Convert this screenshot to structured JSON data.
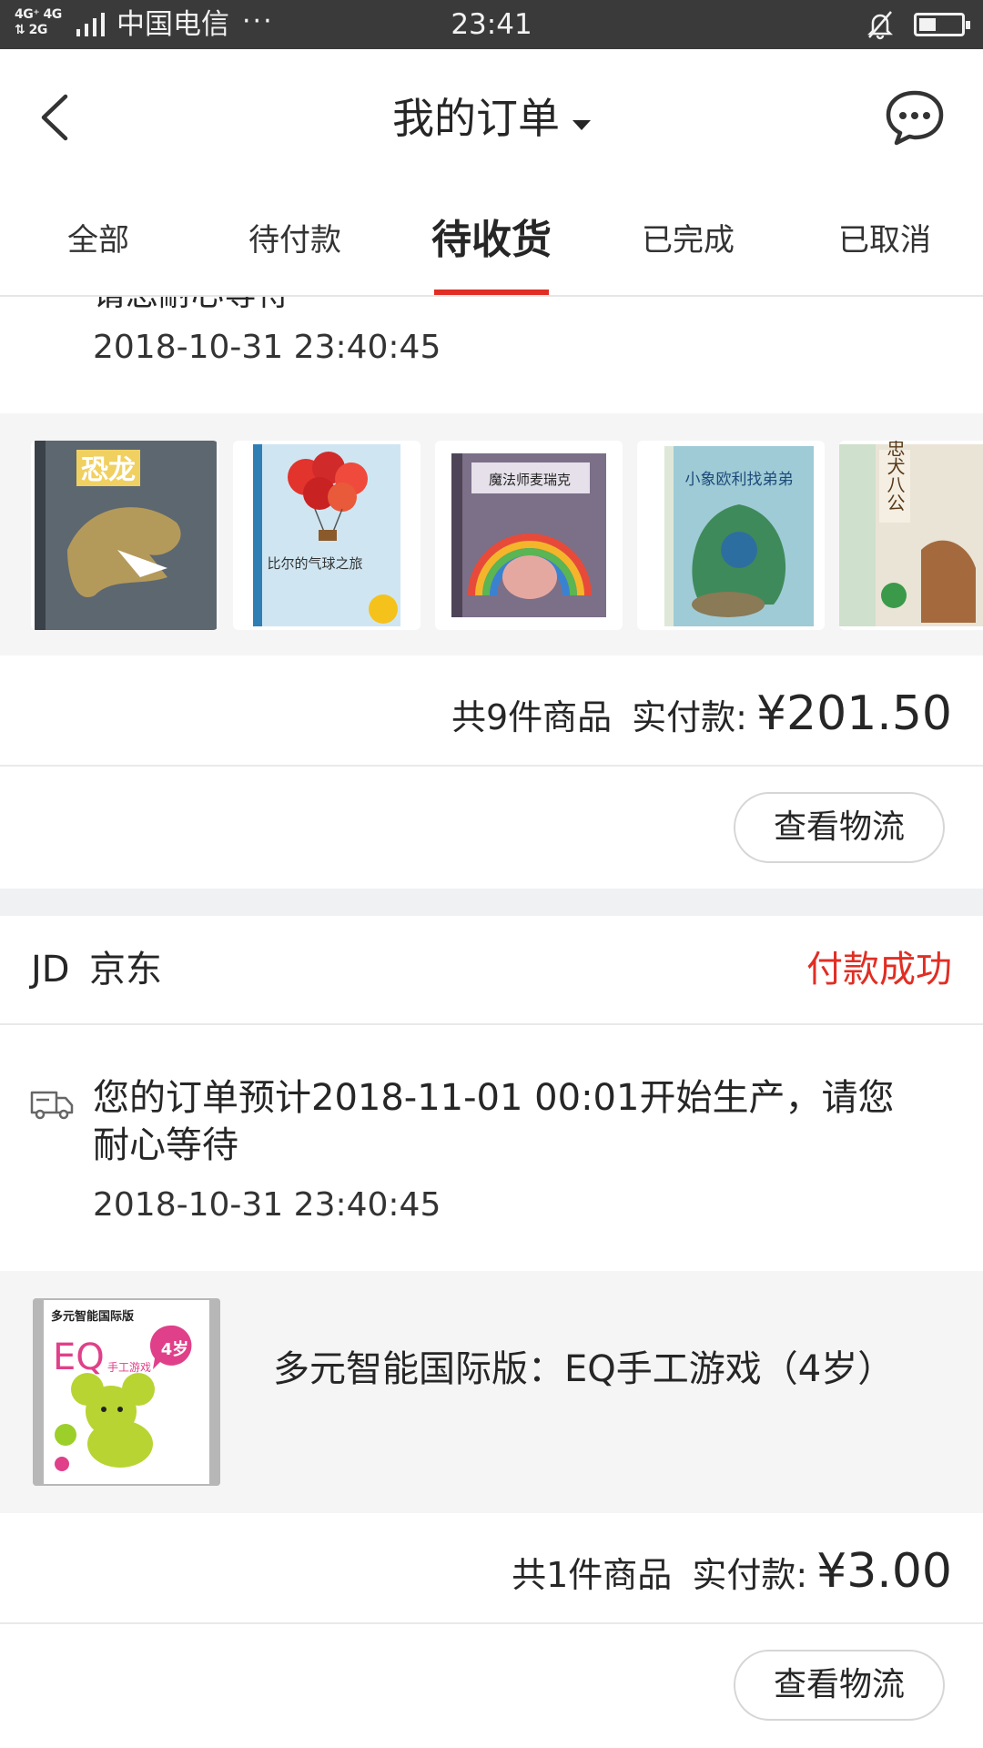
{
  "status_bar": {
    "signal_top": "4G⁺ 4G",
    "signal_bottom": "⇅ 2G",
    "carrier": "中国电信",
    "dots": "···",
    "time": "23:41",
    "battery_level": 0.4,
    "icons": [
      "signal-icon",
      "bell-muted-icon",
      "battery-icon"
    ]
  },
  "header": {
    "title": "我的订单",
    "back_icon": "chevron-left-icon",
    "message_icon": "chat-bubble-icon"
  },
  "tabs": [
    {
      "label": "全部",
      "active": false
    },
    {
      "label": "待付款",
      "active": false
    },
    {
      "label": "待收货",
      "active": true
    },
    {
      "label": "已完成",
      "active": false
    },
    {
      "label": "已取消",
      "active": false
    }
  ],
  "orders": [
    {
      "partial_notice": "请您耐心等待",
      "timestamp": "2018-10-31 23:40:45",
      "products": [
        {
          "cover_title": "恐龙",
          "icon": "book-cover"
        },
        {
          "cover_title": "比尔的气球之旅",
          "icon": "book-cover"
        },
        {
          "cover_title": "魔法师麦瑞克",
          "icon": "book-cover"
        },
        {
          "cover_title": "小象欧利找弟弟",
          "icon": "book-cover"
        },
        {
          "cover_title": "忠犬八公",
          "icon": "book-cover"
        }
      ],
      "summary": {
        "count": "共9件商品",
        "paid_label": "实付款:",
        "amount": "¥201.50"
      },
      "logistics_button": "查看物流"
    },
    {
      "shop_logo": "JD",
      "shop_name": "京东",
      "status": "付款成功",
      "notice": "您的订单预计2018-11-01 00:01开始生产，请您耐心等待",
      "timestamp": "2018-10-31 23:40:45",
      "product": {
        "name": "多元智能国际版：EQ手工游戏（4岁）",
        "cover_brand": "多元智能国际版",
        "cover_title": "EQ",
        "cover_subtitle": "手工游戏",
        "cover_age": "4岁"
      },
      "summary": {
        "count": "共1件商品",
        "paid_label": "实付款:",
        "amount": "¥3.00"
      },
      "logistics_button": "查看物流"
    }
  ],
  "colors": {
    "accent": "#e02e24",
    "status_bar_bg": "#3a3a3a",
    "section_bg": "#f5f5f5",
    "gap_bg": "#eff1f2"
  }
}
